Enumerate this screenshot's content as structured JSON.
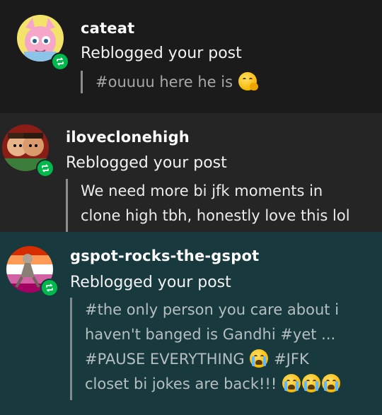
{
  "notifications": [
    {
      "username": "cateat",
      "action": "Reblogged your post",
      "quote_lines": [
        "#ouuuu here he is"
      ],
      "emoji": "shushing-face"
    },
    {
      "username": "iloveclonehigh",
      "action": "Reblogged your post",
      "quote_lines": [
        "We need more bi jfk moments in",
        "clone high tbh, honestly love this lol"
      ]
    },
    {
      "username": "gspot-rocks-the-gspot",
      "action": "Reblogged your post",
      "quote_lines": [
        "#the only person you care about i",
        "haven't banged is Gandhi #yet ...",
        "#PAUSE EVERYTHING",
        "#JFK",
        "closet bi jokes are back!!!"
      ],
      "emoji": "loudly-crying-face"
    }
  ],
  "colors": {
    "badge": "#00b84c",
    "row1_bg": "#1b1b1b",
    "row2_bg": "#252525",
    "row3_bg": "#18393e"
  }
}
